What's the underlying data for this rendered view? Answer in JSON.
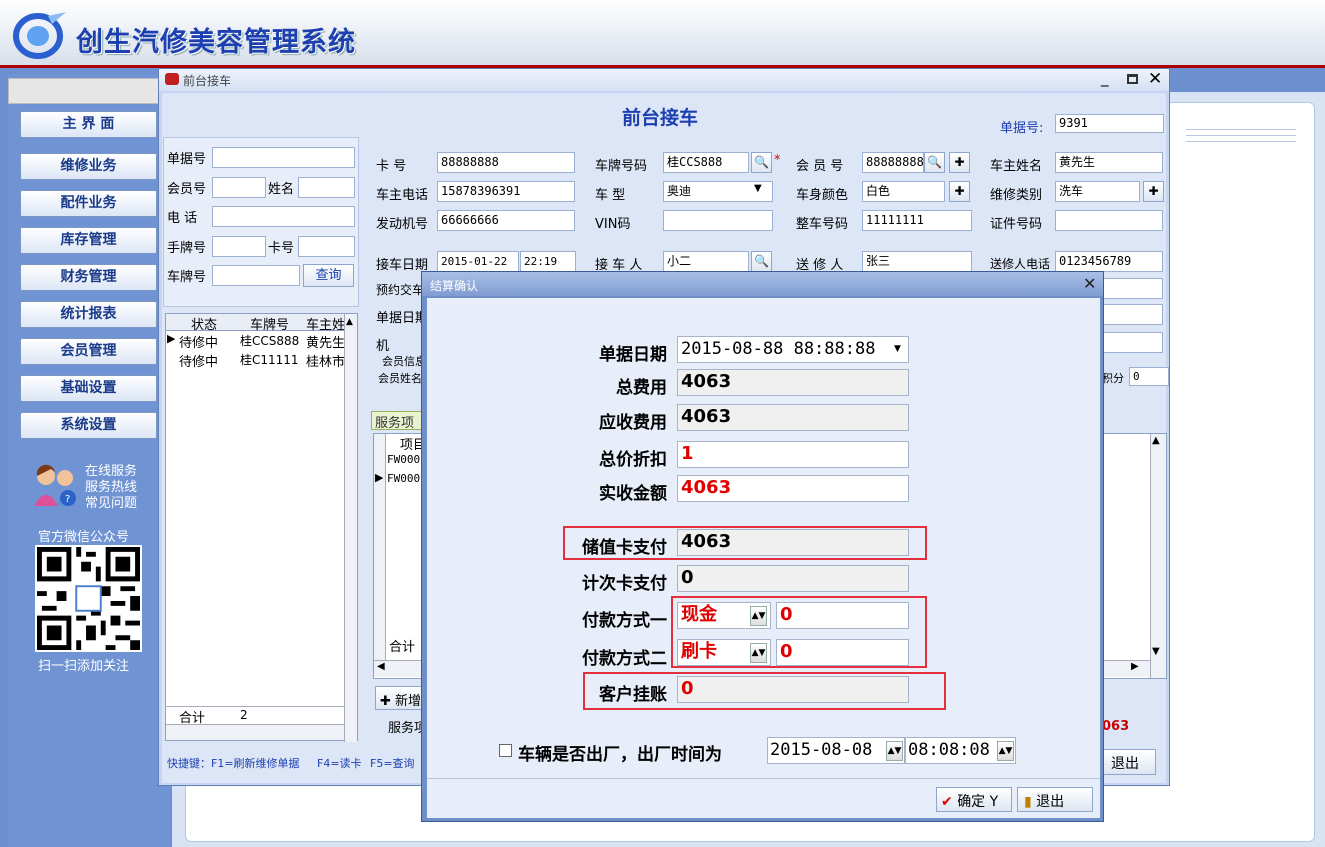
{
  "app": {
    "title": "创生汽修美容管理系统"
  },
  "nav": {
    "items": [
      "主 界 面",
      "维修业务",
      "配件业务",
      "库存管理",
      "财务管理",
      "统计报表",
      "会员管理",
      "基础设置",
      "系统设置"
    ],
    "service": [
      "在线服务",
      "服务热线",
      "常见问题"
    ],
    "wechat": "官方微信公众号",
    "scan": "扫一扫添加关注"
  },
  "win1": {
    "title": "前台接车",
    "heading": "前台接车",
    "doc_no_label": "单据号:",
    "doc_no": "9391",
    "search": {
      "doc_no": "单据号",
      "member_no": "会员号",
      "name": "姓名",
      "phone": "电  话",
      "hand_no": "手牌号",
      "card_no": "卡号",
      "plate": "车牌号",
      "query_btn": "查询"
    },
    "list": {
      "headers": [
        "状态",
        "车牌号",
        "车主姓"
      ],
      "rows": [
        [
          "待修中",
          "桂CCS888",
          "黄先生"
        ],
        [
          "待修中",
          "桂C11111",
          "桂林市"
        ]
      ],
      "total_label": "合计",
      "total_value": "2"
    },
    "form": {
      "card_no_label": "卡    号",
      "card_no": "88888888",
      "plate_label": "车牌号码",
      "plate": "桂CCS888",
      "member_no_label": "会 员 号",
      "member_no": "88888888",
      "owner_label": "车主姓名",
      "owner": "黄先生",
      "owner_phone_label": "车主电话",
      "owner_phone": "15878396391",
      "model_label": "车    型",
      "model": "奥迪",
      "color_label": "车身颜色",
      "color": "白色",
      "repair_type_label": "维修类别",
      "repair_type": "洗车",
      "engine_label": "发动机号",
      "engine": "66666666",
      "vin_label": "VIN码",
      "vin": "",
      "frame_label": "整车号码",
      "frame": "11111111",
      "cert_label": "证件号码",
      "cert": "",
      "date_label": "接车日期",
      "date": "2015-01-22",
      "time": "22:19",
      "receiver_label": "接 车 人",
      "receiver": "小二",
      "sender_label": "送 修 人",
      "sender": "张三",
      "sender_phone_label": "送修人电话",
      "sender_phone": "0123456789",
      "appt_label": "预约交车",
      "doc_date_label": "单据日期",
      "machine_label": "机",
      "member_info_label": "会员信息",
      "member_name_label": "会员姓名",
      "points_label": "积分",
      "points": "0"
    },
    "service_tab": "服务项",
    "svc_header": "项目",
    "svc_rows": [
      "FW000",
      "FW000"
    ],
    "svc_total": "合计",
    "add_btn": "新增",
    "svc_label": "服务项",
    "amount": "063",
    "exit_btn": "退出",
    "shortcuts": [
      "快捷键：F1=刷新维修单据",
      "F4=读卡",
      "F5=查询"
    ]
  },
  "dialog": {
    "title": "结算确认",
    "doc_date_label": "单据日期",
    "doc_date": "2015-08-88 88:88:88",
    "total_label": "总费用",
    "total": "4063",
    "receivable_label": "应收费用",
    "receivable": "4063",
    "discount_label": "总价折扣",
    "discount": "1",
    "actual_label": "实收金额",
    "actual": "4063",
    "stored_label": "储值卡支付",
    "stored": "4063",
    "count_label": "计次卡支付",
    "count": "0",
    "pay1_label": "付款方式一",
    "pay1_method": "现金",
    "pay1_amount": "0",
    "pay2_label": "付款方式二",
    "pay2_method": "刷卡",
    "pay2_amount": "0",
    "credit_label": "客户挂账",
    "credit": "0",
    "leave_label": "车辆是否出厂，出厂时间为",
    "leave_date": "2015-08-08",
    "leave_time": "08:08:08",
    "ok_btn": "确定 Y",
    "exit_btn": "退出"
  }
}
